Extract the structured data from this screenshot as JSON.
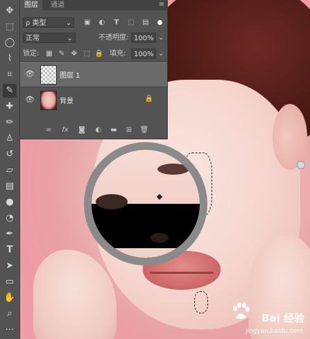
{
  "layers_panel": {
    "tabs": [
      {
        "label": "图层",
        "active": true
      },
      {
        "label": "通道",
        "active": false
      }
    ],
    "filter": {
      "kind_label": "ρ 类型"
    },
    "blend_mode": "正常",
    "opacity_label": "不透明度:",
    "opacity_value": "100%",
    "lock_label": "锁定:",
    "fill_label": "填充:",
    "fill_value": "100%",
    "layers": [
      {
        "name": "图层 1",
        "selected": true,
        "thumb": "transparent",
        "locked": false
      },
      {
        "name": "背景",
        "selected": false,
        "thumb": "photo",
        "locked": true
      }
    ],
    "bottom_icons": [
      "link-icon",
      "fx-icon",
      "mask-icon",
      "adjustment-icon",
      "group-icon",
      "new-layer-icon",
      "trash-icon"
    ]
  },
  "toolbar": {
    "tools": [
      "move-tool",
      "marquee-tool",
      "lasso-tool",
      "quick-select-tool",
      "crop-tool",
      "eyedropper-tool",
      "healing-tool",
      "brush-tool",
      "clone-stamp-tool",
      "history-brush-tool",
      "eraser-tool",
      "gradient-tool",
      "blur-tool",
      "dodge-tool",
      "pen-tool",
      "type-tool",
      "path-select-tool",
      "rectangle-tool",
      "hand-tool",
      "zoom-tool",
      "more-tools"
    ],
    "active_tool": "eyedropper-tool"
  },
  "watermark": {
    "brand": "Bai 经验",
    "url": "jingyan.baidu.com"
  }
}
